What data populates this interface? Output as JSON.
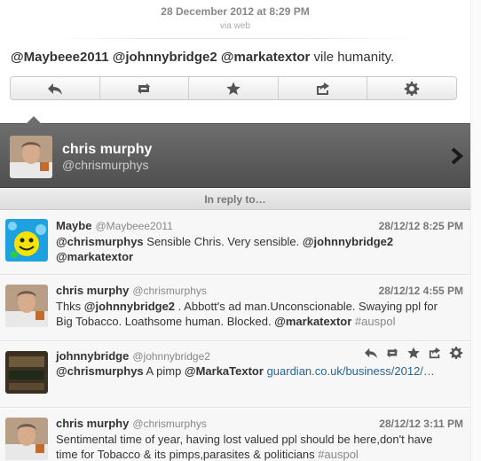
{
  "detail": {
    "date": "28 December 2012 at 8:29 PM",
    "via": "via web",
    "mention1": "@Maybeee2011",
    "mention2": "@johnnybridge2",
    "mention3": "@markatextor",
    "rest": " vile humanity."
  },
  "actions": {
    "icons": [
      "reply-icon",
      "retweet-icon",
      "favorite-icon",
      "share-icon",
      "gear-icon"
    ]
  },
  "profile": {
    "name": "chris murphy",
    "handle": "@chrismurphys"
  },
  "reply_header": "In reply to…",
  "tweets": [
    {
      "name": "Maybe",
      "handle": "@Maybeee2011",
      "time": "28/12/12 8:25 PM",
      "m1": "@chrismurphys",
      "t1": " Sensible Chris. Very sensible. ",
      "m2": "@johnnybridge2",
      "t2": " ",
      "m3": "@markatextor"
    },
    {
      "name": "chris murphy",
      "handle": "@chrismurphys",
      "time": "28/12/12 4:55 PM",
      "t0": "Thks ",
      "m1": "@johnnybridge2",
      "t1": " . Abbott's ad man.Unconscionable. Swaying ppl for Big Tobacco. Loathsome human. Blocked. ",
      "m2": "@markatextor",
      "t2": " ",
      "tag": "#auspol"
    },
    {
      "name": "johnnybridge",
      "handle": "@johnnybridge2",
      "m1": "@chrismurphys",
      "t1": " A pimp ",
      "m2": "@MarkaTextor",
      "t2": " ",
      "link": "guardian.co.uk/business/2012/…"
    },
    {
      "name": "chris murphy",
      "handle": "@chrismurphys",
      "time": "28/12/12 3:11 PM",
      "t1": "Sentimental time of year, having lost valued ppl should be here,don't have time for Tobacco & its pimps,parasites & politicians ",
      "tag": "#auspol"
    }
  ],
  "colors": {
    "profile_bg": "#5e5e5e",
    "link": "#2a6496",
    "maybe_avatar_bg": "#1da1e0",
    "smiley": "#f5e400"
  }
}
